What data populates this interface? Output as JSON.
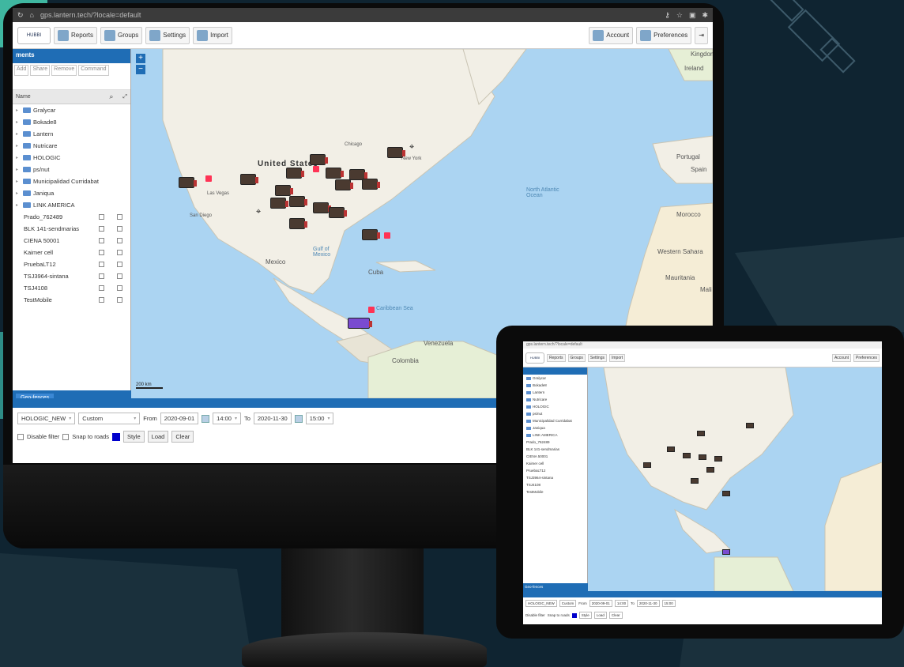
{
  "browser": {
    "url": "gps.lantern.tech/?locale=default"
  },
  "toolbar": {
    "logo": "HUBBI",
    "reports": "Reports",
    "groups": "Groups",
    "settings": "Settings",
    "import": "Import",
    "account": "Account",
    "preferences": "Preferences"
  },
  "left_panel": {
    "header": "ments",
    "tabs": [
      "Add",
      "Share",
      "Remove",
      "Command"
    ],
    "column_name": "Name",
    "groups": [
      "Gralycar",
      "Bokade8",
      "Lantern",
      "Nutricare",
      "HOLOGIC",
      "ps/nut",
      "Municipalidad Curridabat",
      "Janiqua",
      "LINK AMERICA"
    ],
    "devices": [
      "Prado_762489",
      "BLK 141-sendmarias",
      "CIENA 50001",
      "Kaimer cell",
      "PruebaLT12",
      "TSJ3964-sintana",
      "TSJ4108",
      "TestMobile"
    ],
    "bottom_tab": "Geo-fences"
  },
  "map": {
    "labels": {
      "us": "United States",
      "mexico": "Mexico",
      "portugal": "Portugal",
      "spain": "Spain",
      "morocco": "Morocco",
      "mauritania": "Mauritania",
      "venezuela": "Venezuela",
      "colombia": "Colombia",
      "ireland": "Ireland",
      "kingdom": "Kingdom",
      "cuba": "Cuba",
      "western_sahara": "Western Sahara",
      "north_atlantic": "North Atlantic Ocean",
      "gulf": "Gulf of Mexico",
      "caribbean": "Caribbean Sea",
      "chicago": "Chicago",
      "new_york": "New York",
      "las_vegas": "Las Vegas",
      "san_diego": "San Diego",
      "mali": "Mali"
    },
    "scale": "200 km"
  },
  "bottom_panel": {
    "device": "HOLOGIC_NEW",
    "period": "Custom",
    "from_label": "From",
    "from_date": "2020-09-01",
    "from_time": "14:00",
    "to_label": "To",
    "to_date": "2020-11-30",
    "to_time": "15:00",
    "disable_filter": "Disable filter",
    "snap_to_roads": "Snap to roads",
    "style": "Style",
    "load": "Load",
    "clear": "Clear"
  },
  "tablet": {
    "bottom_tab": "Geo-fences",
    "device": "HOLOGIC_NEW",
    "period": "Custom",
    "account": "Account",
    "preferences": "Preferences"
  },
  "colors": {
    "accent": "#1f6db5",
    "background": "#0f2431",
    "map_water": "#abd4f2",
    "map_land": "#f2efe6"
  }
}
